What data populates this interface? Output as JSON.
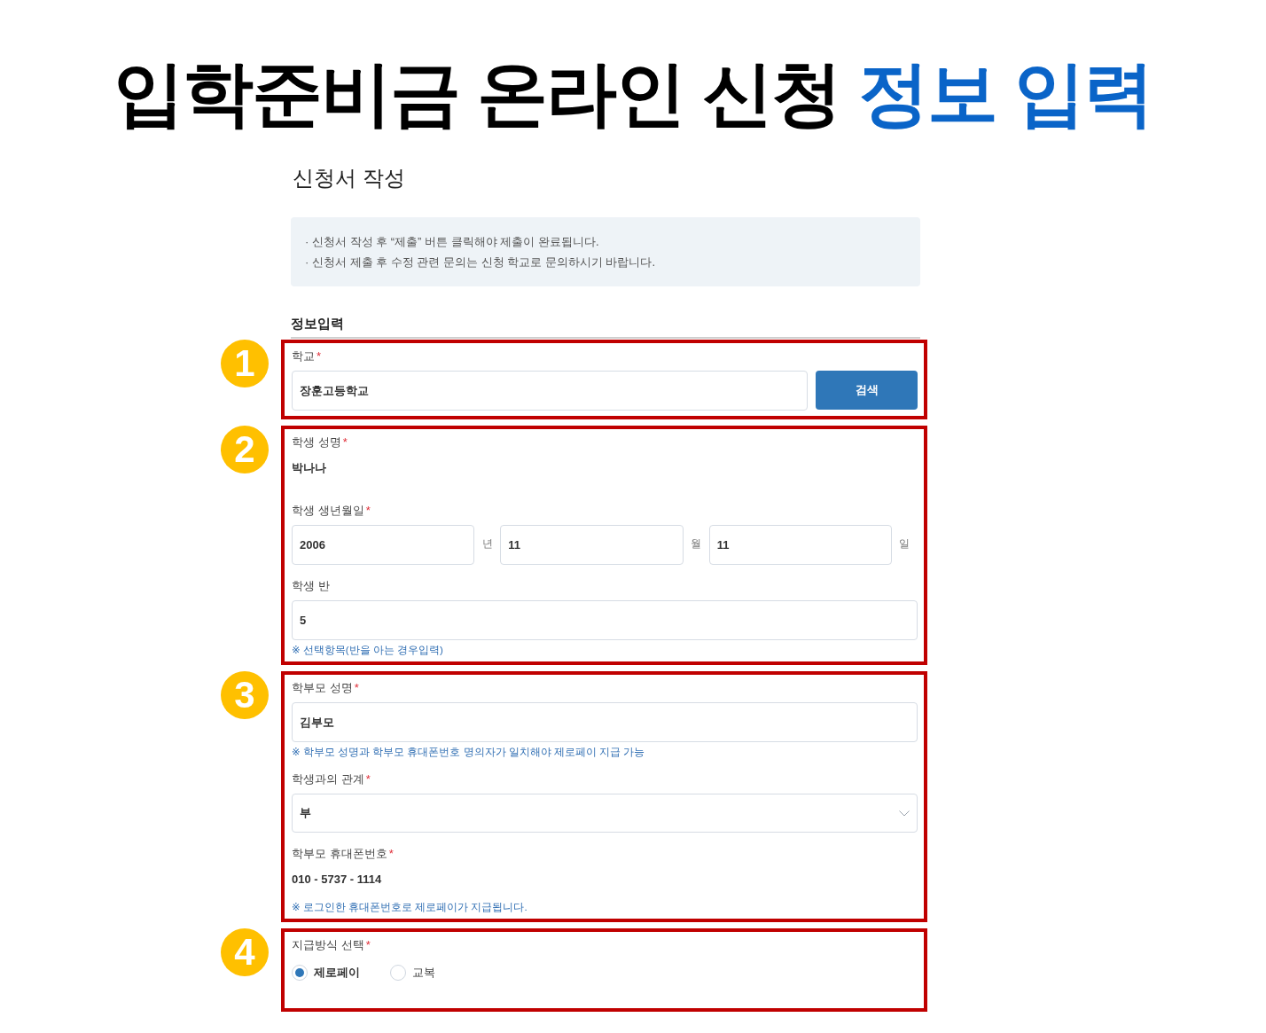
{
  "headline": {
    "text": "입학준비금 온라인 신청",
    "highlight": "정보 입력"
  },
  "form": {
    "title": "신청서 작성",
    "notices": [
      "· 신청서 작성 후 “제출” 버튼 클릭해야 제출이 완료됩니다.",
      "· 신청서 제출 후 수정 관련 문의는 신청 학교로 문의하시기 바랍니다."
    ],
    "section_title": "정보입력",
    "steps": [
      {
        "number": "1",
        "fields": [
          {
            "kind": "search",
            "label": "학교",
            "required_mark": "*",
            "value": "장훈고등학교",
            "button": "검색"
          }
        ]
      },
      {
        "number": "2",
        "fields": [
          {
            "kind": "text",
            "label": "학생 성명",
            "required_mark": "*",
            "value": "박나나"
          },
          {
            "kind": "date",
            "label": "학생 생년월일",
            "required_mark": "*",
            "parts": [
              {
                "value": "2006",
                "unit": "년"
              },
              {
                "value": "11",
                "unit": "월"
              },
              {
                "value": "11",
                "unit": "일"
              }
            ]
          },
          {
            "kind": "input",
            "label": "학생 반",
            "value": "5",
            "hint": "※ 선택항목(반을 아는 경우입력)"
          }
        ]
      },
      {
        "number": "3",
        "fields": [
          {
            "kind": "input",
            "label": "학부모 성명",
            "required_mark": "*",
            "value": "김부모",
            "hint": "※ 학부모 성명과 학부모 휴대폰번호 명의자가 일치해야 제로페이 지급 가능"
          },
          {
            "kind": "select",
            "label": "학생과의 관계",
            "required_mark": "*",
            "value": "부"
          },
          {
            "kind": "text",
            "label": "학부모 휴대폰번호",
            "required_mark": "*",
            "value": "010 - 5737 - 1114",
            "hint": "※ 로그인한 휴대폰번호로 제로페이가 지급됩니다."
          }
        ]
      },
      {
        "number": "4",
        "fields": [
          {
            "kind": "radio",
            "label": "지급방식 선택",
            "required_mark": "*",
            "options": [
              {
                "label": "제로페이",
                "selected": true
              },
              {
                "label": "교복",
                "selected": false
              }
            ]
          }
        ]
      }
    ]
  }
}
